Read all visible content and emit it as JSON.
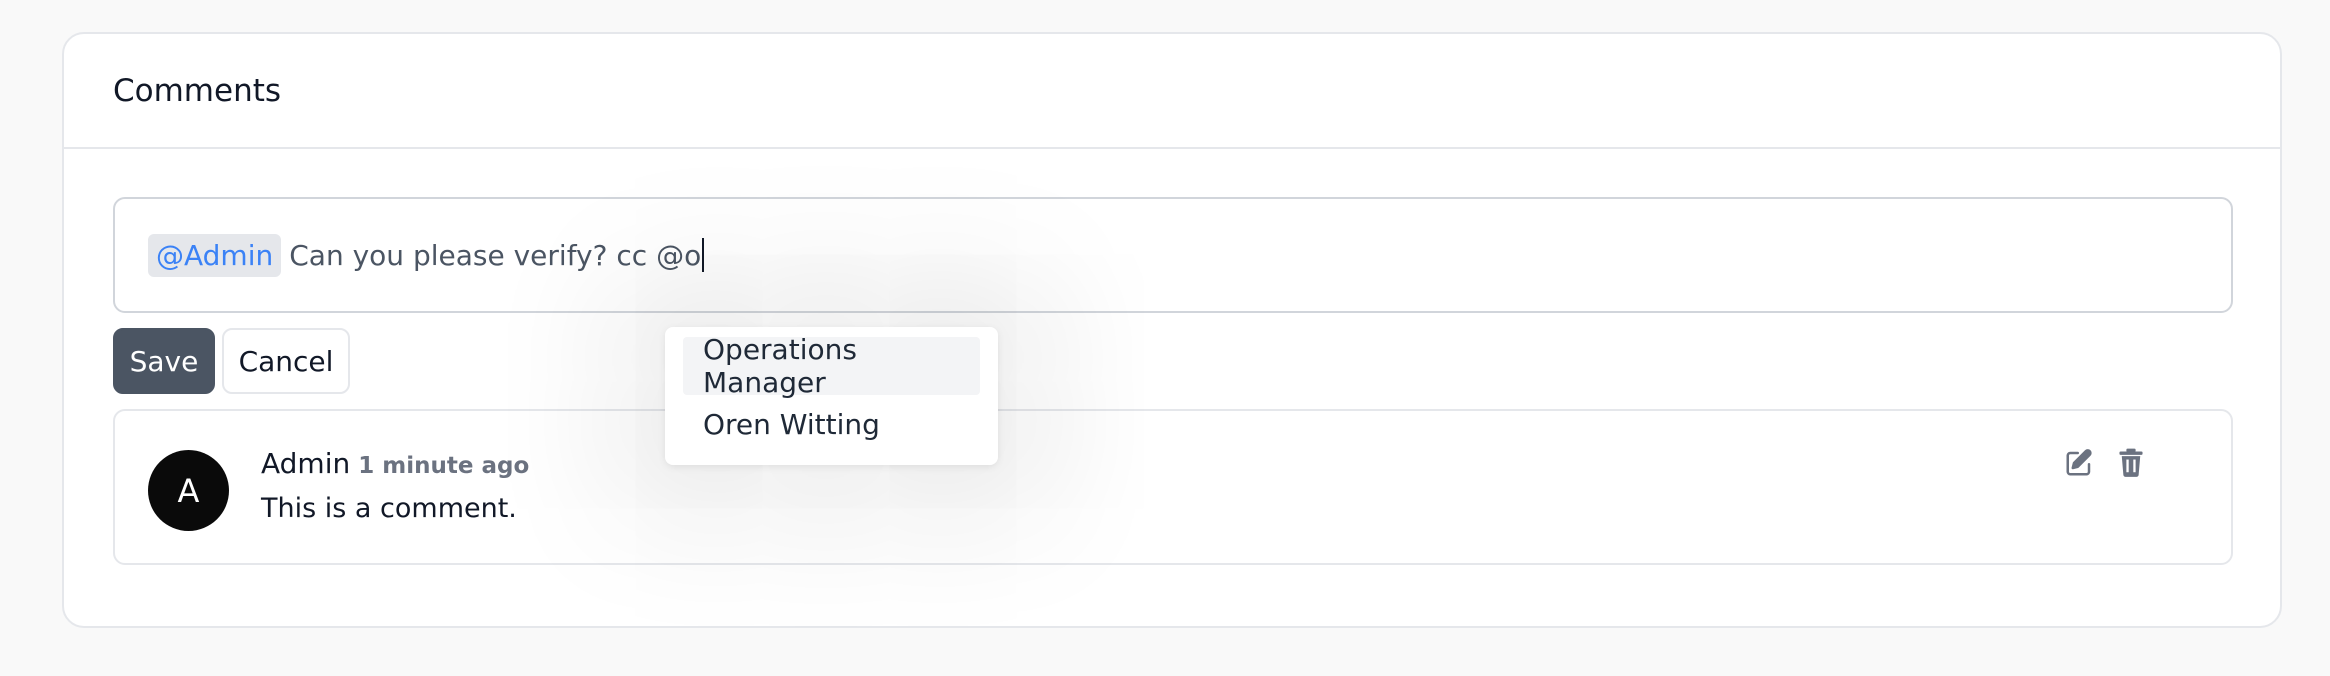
{
  "card": {
    "title": "Comments"
  },
  "editor": {
    "mention": "@Admin",
    "text": "Can you please verify? cc @o"
  },
  "buttons": {
    "save_label": "Save",
    "cancel_label": "Cancel"
  },
  "mention_menu": {
    "items": [
      {
        "label": "Operations Manager",
        "active": true
      },
      {
        "label": "Oren Witting",
        "active": false
      }
    ]
  },
  "comments": [
    {
      "avatar_initial": "A",
      "author": "Admin",
      "time": "1 minute ago",
      "body": "This is a comment.",
      "actions": [
        "edit-icon",
        "trash-icon"
      ]
    }
  ],
  "colors": {
    "accent": "#3b82f6",
    "save_button": "#4b5563",
    "avatar": "#0a0a0a"
  }
}
